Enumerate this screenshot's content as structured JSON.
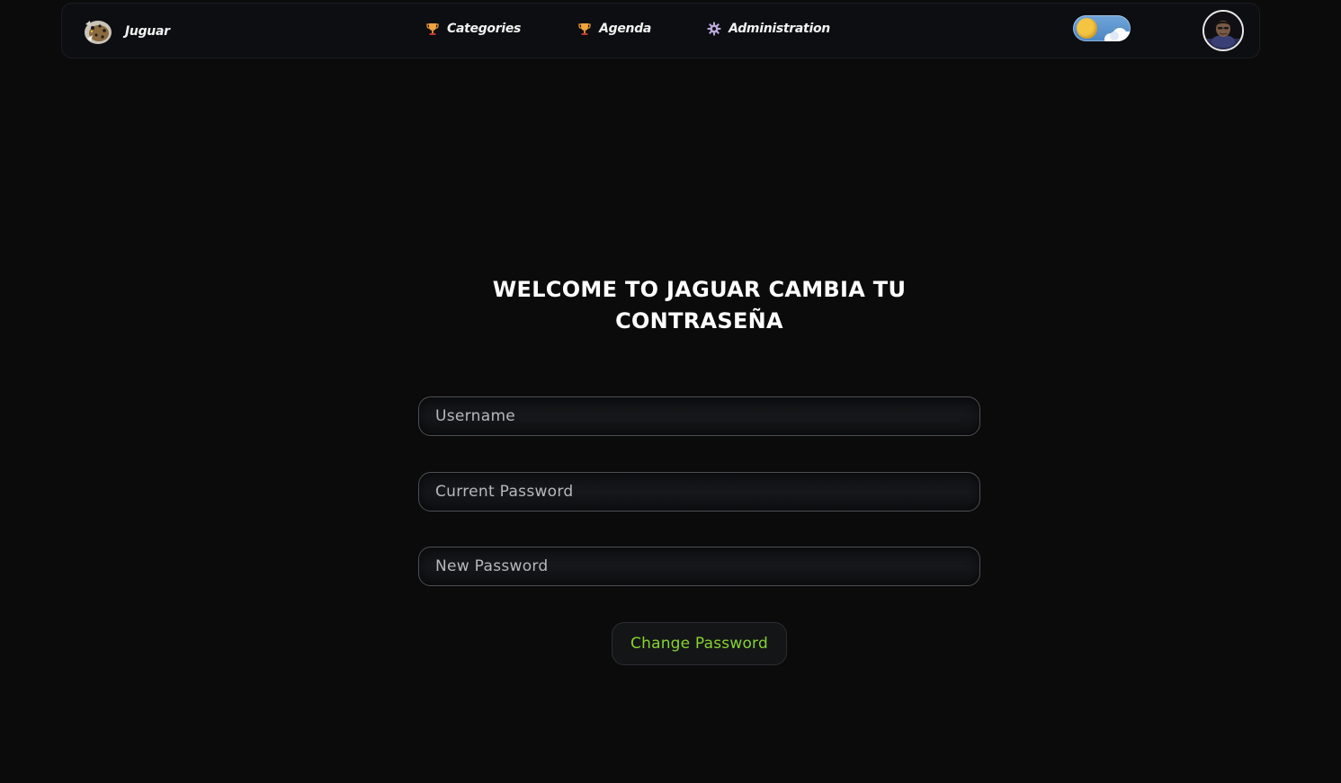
{
  "brand": {
    "name": "Juguar",
    "logo_icon": "jaguar-logo-icon"
  },
  "nav": {
    "items": [
      {
        "label": "Categories",
        "icon": "trophy-icon"
      },
      {
        "label": "Agenda",
        "icon": "trophy-icon"
      },
      {
        "label": "Administration",
        "icon": "gear-icon"
      }
    ]
  },
  "theme_toggle": {
    "mode": "light",
    "icon": "sun-icon"
  },
  "user": {
    "avatar_icon": "user-avatar"
  },
  "form": {
    "title": "WELCOME TO JAGUAR CAMBIA TU CONTRASEÑA",
    "username_placeholder": "Username",
    "current_password_placeholder": "Current Password",
    "new_password_placeholder": "New Password",
    "submit_label": "Change Password"
  },
  "colors": {
    "background": "#0b0b0c",
    "accent_green": "#86d42f",
    "trophy_gold": "#f0a23b"
  }
}
